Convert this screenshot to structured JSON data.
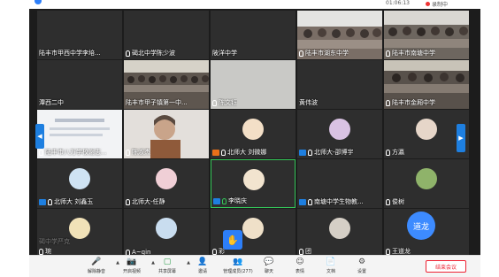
{
  "topbar": {
    "time": "01:06:13",
    "recording": "录制中"
  },
  "tiles": [
    {
      "caption": "陆丰市甲西中学李培...",
      "mic": false,
      "badge": ""
    },
    {
      "caption": "碣北中学陈少波",
      "mic": true,
      "badge": ""
    },
    {
      "caption": "陂洋中学",
      "mic": false,
      "badge": ""
    },
    {
      "caption": "陆丰市湖东中学",
      "mic": true,
      "badge": ""
    },
    {
      "caption": "陆丰市南塘中学",
      "mic": true,
      "badge": ""
    },
    {
      "caption": "潭西二中",
      "mic": false,
      "badge": ""
    },
    {
      "caption": "陆丰市甲子镇第一中...",
      "mic": false,
      "badge": ""
    },
    {
      "caption": "陈文钰",
      "mic": true,
      "badge": ""
    },
    {
      "caption": "黄伟波",
      "mic": false,
      "badge": ""
    },
    {
      "caption": "陆丰市金厢中学",
      "mic": true,
      "badge": ""
    },
    {
      "caption": "陆丰市八万学校谢志...",
      "mic": true,
      "badge": ""
    },
    {
      "caption": "陈淑杰",
      "mic": true,
      "badge": ""
    },
    {
      "caption": "北师大 刘微娜",
      "mic": true,
      "badge": "orange"
    },
    {
      "caption": "北师大-邵博宇",
      "mic": true,
      "badge": "blue"
    },
    {
      "caption": "方瀛",
      "mic": true,
      "badge": ""
    },
    {
      "caption": "北师大 刘鑫玉",
      "mic": true,
      "badge": "blue"
    },
    {
      "caption": "北师大-任静",
      "mic": true,
      "badge": ""
    },
    {
      "caption": "李晓庆",
      "mic": true,
      "badge": "blue"
    },
    {
      "caption": "南塘中学生物教...",
      "mic": true,
      "badge": "blue"
    },
    {
      "caption": "俊树",
      "mic": true,
      "badge": ""
    },
    {
      "caption": "碣中学严克",
      "mic": false,
      "badge": ""
    },
    {
      "caption": "A~qin",
      "mic": true,
      "badge": ""
    },
    {
      "caption": "彩",
      "mic": true,
      "badge": ""
    },
    {
      "caption": "团",
      "mic": true,
      "badge": ""
    },
    {
      "caption": "王道龙",
      "mic": true,
      "badge": ""
    }
  ],
  "extra_caption": "琬",
  "avatar_label": "道龙",
  "toolbar": {
    "unmute": "解除静音",
    "video": "开启视频",
    "share": "共享屏幕",
    "invite": "邀请",
    "members": "管理成员(277)",
    "chat": "聊天",
    "reaction": "表情",
    "docs": "文档",
    "settings": "设置",
    "end": "结束会议"
  }
}
